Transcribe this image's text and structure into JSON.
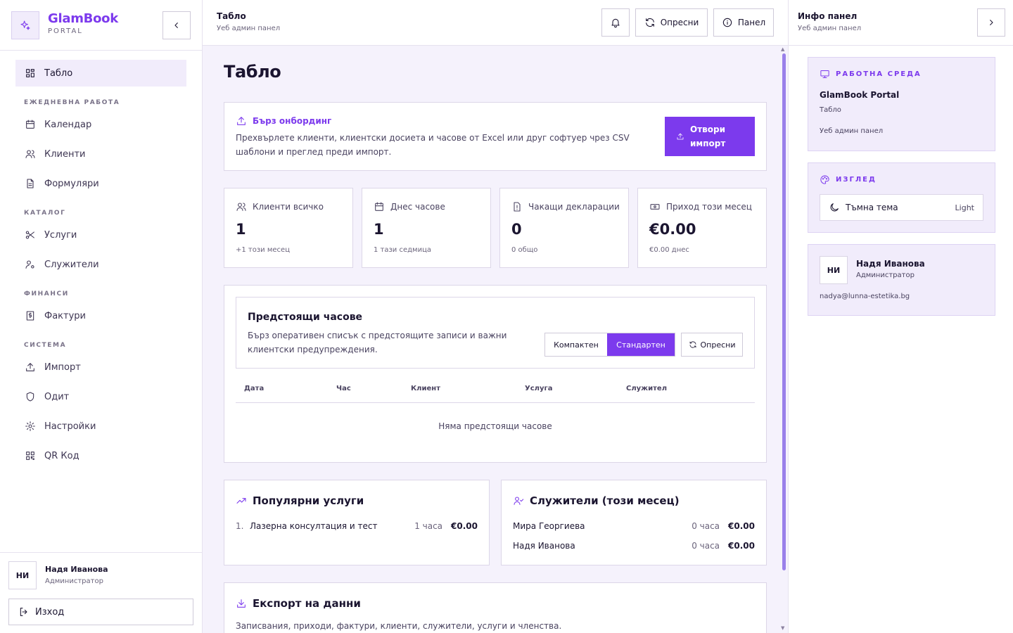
{
  "brand": {
    "name": "GlamBook",
    "sub": "PORTAL"
  },
  "nav": {
    "items": [
      {
        "label": "Табло",
        "icon": "grid-icon"
      },
      {
        "label": "Календар",
        "icon": "calendar-icon"
      },
      {
        "label": "Клиенти",
        "icon": "users-icon"
      },
      {
        "label": "Формуляри",
        "icon": "file-icon"
      },
      {
        "label": "Услуги",
        "icon": "scissors-icon"
      },
      {
        "label": "Служители",
        "icon": "user-cog-icon"
      },
      {
        "label": "Фактури",
        "icon": "receipt-icon"
      },
      {
        "label": "Импорт",
        "icon": "upload-icon"
      },
      {
        "label": "Одит",
        "icon": "shield-icon"
      },
      {
        "label": "Настройки",
        "icon": "gear-icon"
      },
      {
        "label": "QR Код",
        "icon": "qr-icon"
      }
    ],
    "sections": [
      "ЕЖЕДНЕВНА РАБОТА",
      "КАТАЛОГ",
      "ФИНАНСИ",
      "СИСТЕМА"
    ]
  },
  "user": {
    "initials": "НИ",
    "name": "Надя Иванова",
    "role": "Администратор",
    "email": "nadya@lunna-estetika.bg"
  },
  "logout_label": "Изход",
  "topbar": {
    "title": "Табло",
    "sub": "Уеб админ панел",
    "refresh_label": "Опресни",
    "panel_label": "Панел"
  },
  "page": {
    "title": "Табло"
  },
  "onboarding": {
    "title": "Бърз онбординг",
    "text": "Прехвърлете клиенти, клиентски досиета и часове от Excel или друг софтуер чрез CSV шаблони и преглед преди импорт.",
    "button": "Отвори импорт"
  },
  "stats": [
    {
      "label": "Клиенти всичко",
      "value": "1",
      "note": "+1 този месец"
    },
    {
      "label": "Днес часове",
      "value": "1",
      "note": "1 тази седмица"
    },
    {
      "label": "Чакащи декларации",
      "value": "0",
      "note": "0 общо"
    },
    {
      "label": "Приход този месец",
      "value": "€0.00",
      "note": "€0.00 днес"
    }
  ],
  "upcoming": {
    "title": "Предстоящи часове",
    "desc": "Бърз оперативен списък с предстоящите записи и важни клиентски предупреждения.",
    "compact": "Компактен",
    "standard": "Стандартен",
    "refresh": "Опресни",
    "columns": [
      "Дата",
      "Час",
      "Клиент",
      "Услуга",
      "Служител"
    ],
    "empty": "Няма предстоящи часове"
  },
  "popular": {
    "title": "Популярни услуги",
    "rows": [
      {
        "n": "1.",
        "name": "Лазерна консултация и тест",
        "hours": "1 часа",
        "amount": "€0.00"
      }
    ]
  },
  "staff": {
    "title": "Служители (този месец)",
    "rows": [
      {
        "name": "Мира Георгиева",
        "hours": "0 часа",
        "amount": "€0.00"
      },
      {
        "name": "Надя Иванова",
        "hours": "0 часа",
        "amount": "€0.00"
      }
    ]
  },
  "export": {
    "title": "Експорт на данни",
    "text": "Записвания, приходи, фактури, клиенти, служители, услуги и членства."
  },
  "rpanel": {
    "title": "Инфо панел",
    "sub": "Уеб админ панел",
    "workspace": {
      "head": "РАБОТНА СРЕДА",
      "name": "GlamBook Portal",
      "page": "Табло",
      "sub": "Уеб админ панел"
    },
    "look": {
      "head": "ИЗГЛЕД",
      "theme_label": "Тъмна тема",
      "theme_value": "Light"
    }
  },
  "colors": {
    "accent": "#7c3aed",
    "accent_soft": "#f1ecfb",
    "main_bg": "#f5f2fc"
  }
}
